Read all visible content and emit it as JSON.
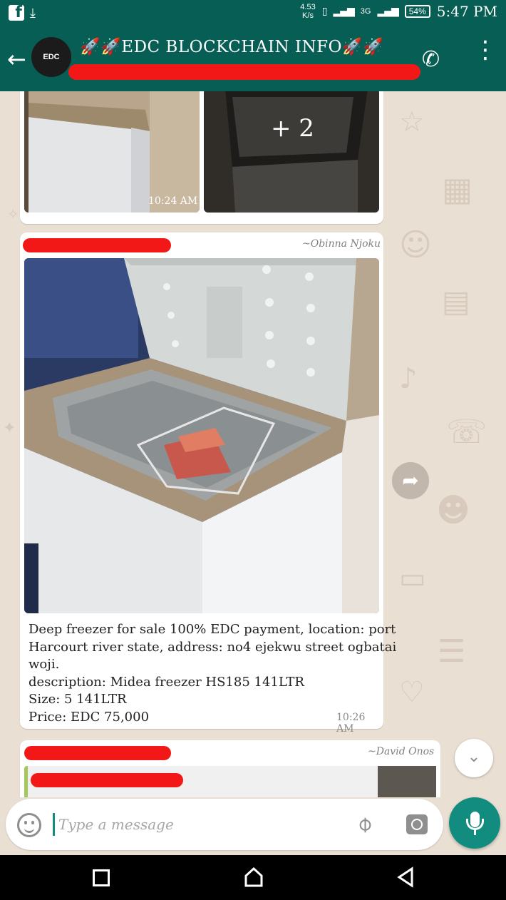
{
  "status_bar": {
    "speed": "4.53",
    "speed_unit": "K/s",
    "network": "3G",
    "battery": "54%",
    "time": "5:47 PM"
  },
  "header": {
    "title": "🚀🚀EDC BLOCKCHAIN INFO🚀🚀",
    "avatar_text": "EDC"
  },
  "messages": [
    {
      "time": "10:24 AM",
      "more_images": "+ 2"
    },
    {
      "sender": "~Obinna Njoku",
      "caption_lines": [
        "Deep freezer for sale 100% EDC payment, location: port",
        "Harcourt river state, address: no4 ejekwu street ogbatai",
        "woji.",
        "description: Midea freezer HS185 141LTR",
        "Size: 5 141LTR",
        "Price: EDC 75,000"
      ],
      "time": "10:26 AM"
    },
    {
      "sender": "~David Onos"
    }
  ],
  "input": {
    "placeholder": "Type a message"
  },
  "colors": {
    "header": "#075e54",
    "accent": "#128c7e",
    "chat_background": "#e9dfd3",
    "redaction": "#f21818"
  },
  "icons": [
    "facebook-icon",
    "download-icon",
    "vibrate-icon",
    "signal-icon",
    "back-arrow-icon",
    "add-call-icon",
    "more-options-icon",
    "forward-icon",
    "scroll-down-icon",
    "emoji-icon",
    "attach-icon",
    "camera-icon",
    "mic-icon",
    "nav-recents-icon",
    "nav-home-icon",
    "nav-back-icon"
  ]
}
